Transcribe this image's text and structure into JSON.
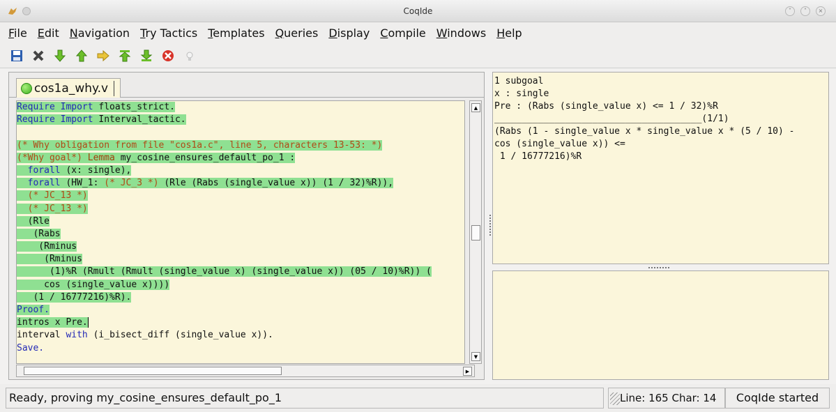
{
  "window": {
    "title": "CoqIde"
  },
  "menu": [
    "File",
    "Edit",
    "Navigation",
    "Try Tactics",
    "Templates",
    "Queries",
    "Display",
    "Compile",
    "Windows",
    "Help"
  ],
  "toolbar": {
    "icons": [
      "save-icon",
      "close-icon",
      "forward-icon",
      "backward-icon",
      "go-to-cursor-icon",
      "go-to-start-icon",
      "go-to-end-icon",
      "interrupt-icon",
      "hint-icon"
    ]
  },
  "tab": {
    "label": "cos1a_why.v"
  },
  "editor": {
    "lines": [
      "Require Import floats_strict.",
      "Require Import Interval_tactic.",
      "",
      "(* Why obligation from file \"cos1a.c\", line 5, characters 13-53: *)",
      "(*Why goal*) Lemma my_cosine_ensures_default_po_1 :",
      "  forall (x: single),",
      "  forall (HW_1: (* JC_3 *) (Rle (Rabs (single_value x)) (1 / 32)%R)),",
      "  (* JC_13 *)",
      "  (* JC_13 *)",
      "  (Rle",
      "   (Rabs",
      "    (Rminus",
      "     (Rminus",
      "      (1)%R (Rmult (Rmult (single_value x) (single_value x)) (05 / 10)%R)) (",
      "     cos (single_value x))))",
      "   (1 / 16777216)%R).",
      "Proof.",
      "intros x Pre.",
      "interval with (i_bisect_diff (single_value x)).",
      "Save."
    ]
  },
  "goals": {
    "lines": [
      "1 subgoal",
      "x : single",
      "Pre : (Rabs (single_value x) <= 1 / 32)%R",
      "______________________________________(1/1)",
      "(Rabs (1 - single_value x * single_value x * (5 / 10) -",
      "cos (single_value x)) <=",
      " 1 / 16777216)%R"
    ]
  },
  "status": {
    "message": "Ready, proving my_cosine_ensures_default_po_1",
    "position": "Line:  165 Char:  14",
    "right": "CoqIde started"
  },
  "colors": {
    "processed_highlight": "#8fe092",
    "editor_bg": "#fbf6db",
    "keyword": "#2329b6",
    "comment": "#b04a16"
  }
}
